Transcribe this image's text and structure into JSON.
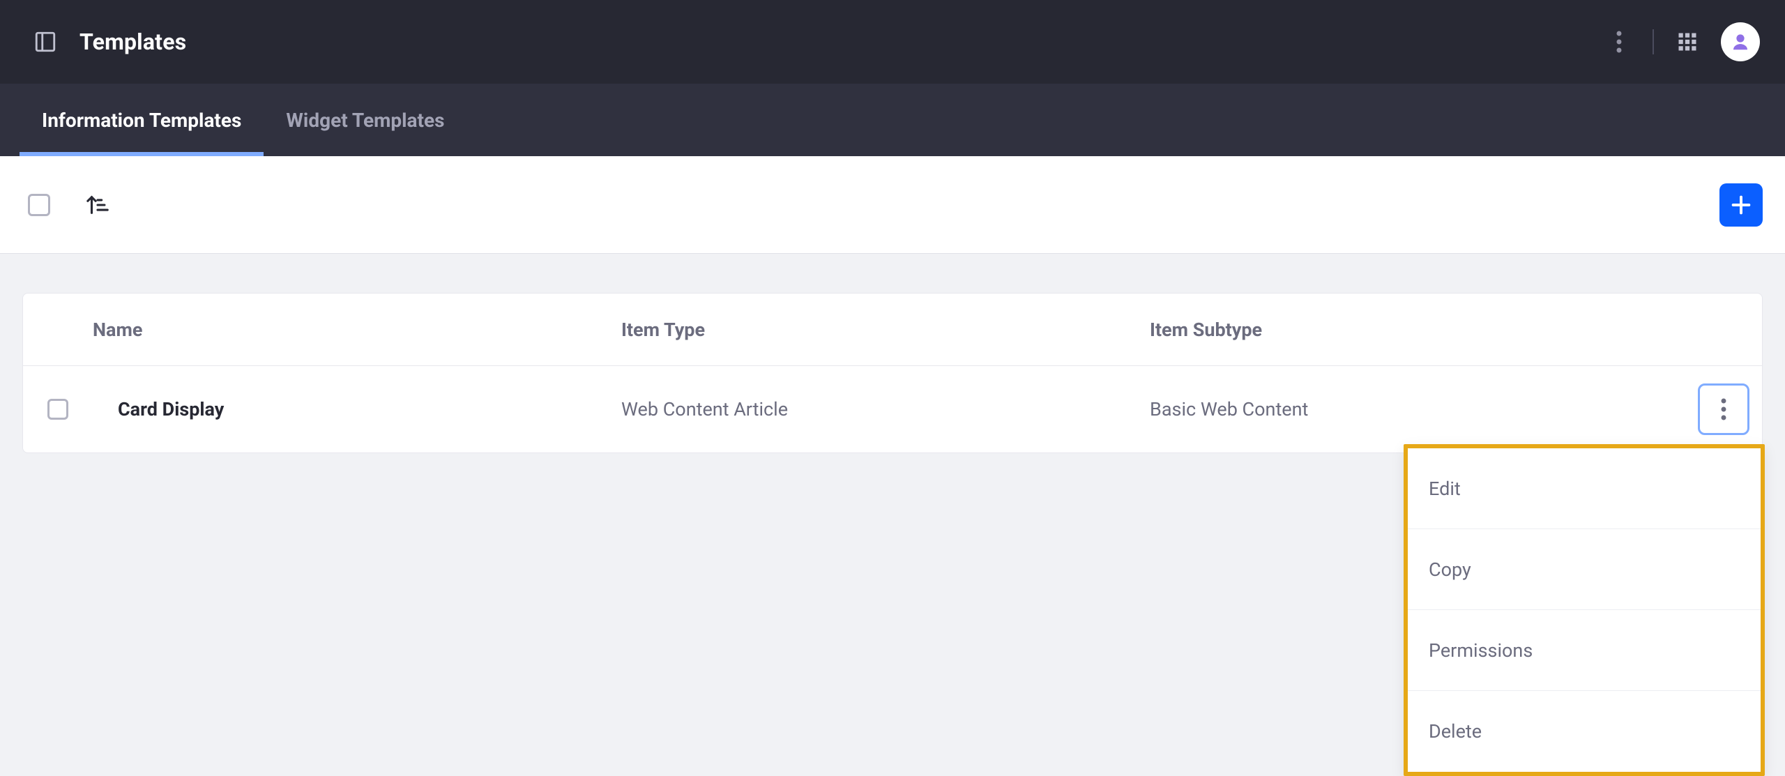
{
  "header": {
    "title": "Templates"
  },
  "tabs": [
    {
      "label": "Information Templates",
      "active": true
    },
    {
      "label": "Widget Templates",
      "active": false
    }
  ],
  "table": {
    "columns": {
      "name": "Name",
      "itemType": "Item Type",
      "itemSubtype": "Item Subtype"
    },
    "rows": [
      {
        "name": "Card Display",
        "itemType": "Web Content Article",
        "itemSubtype": "Basic Web Content"
      }
    ]
  },
  "dropdown": {
    "items": [
      "Edit",
      "Copy",
      "Permissions",
      "Delete"
    ]
  },
  "colors": {
    "accent": "#0b5fff",
    "highlightBorder": "#e6a817",
    "tabUnderline": "#80acff",
    "headerBg": "#272833",
    "tabsBg": "#30313f"
  }
}
